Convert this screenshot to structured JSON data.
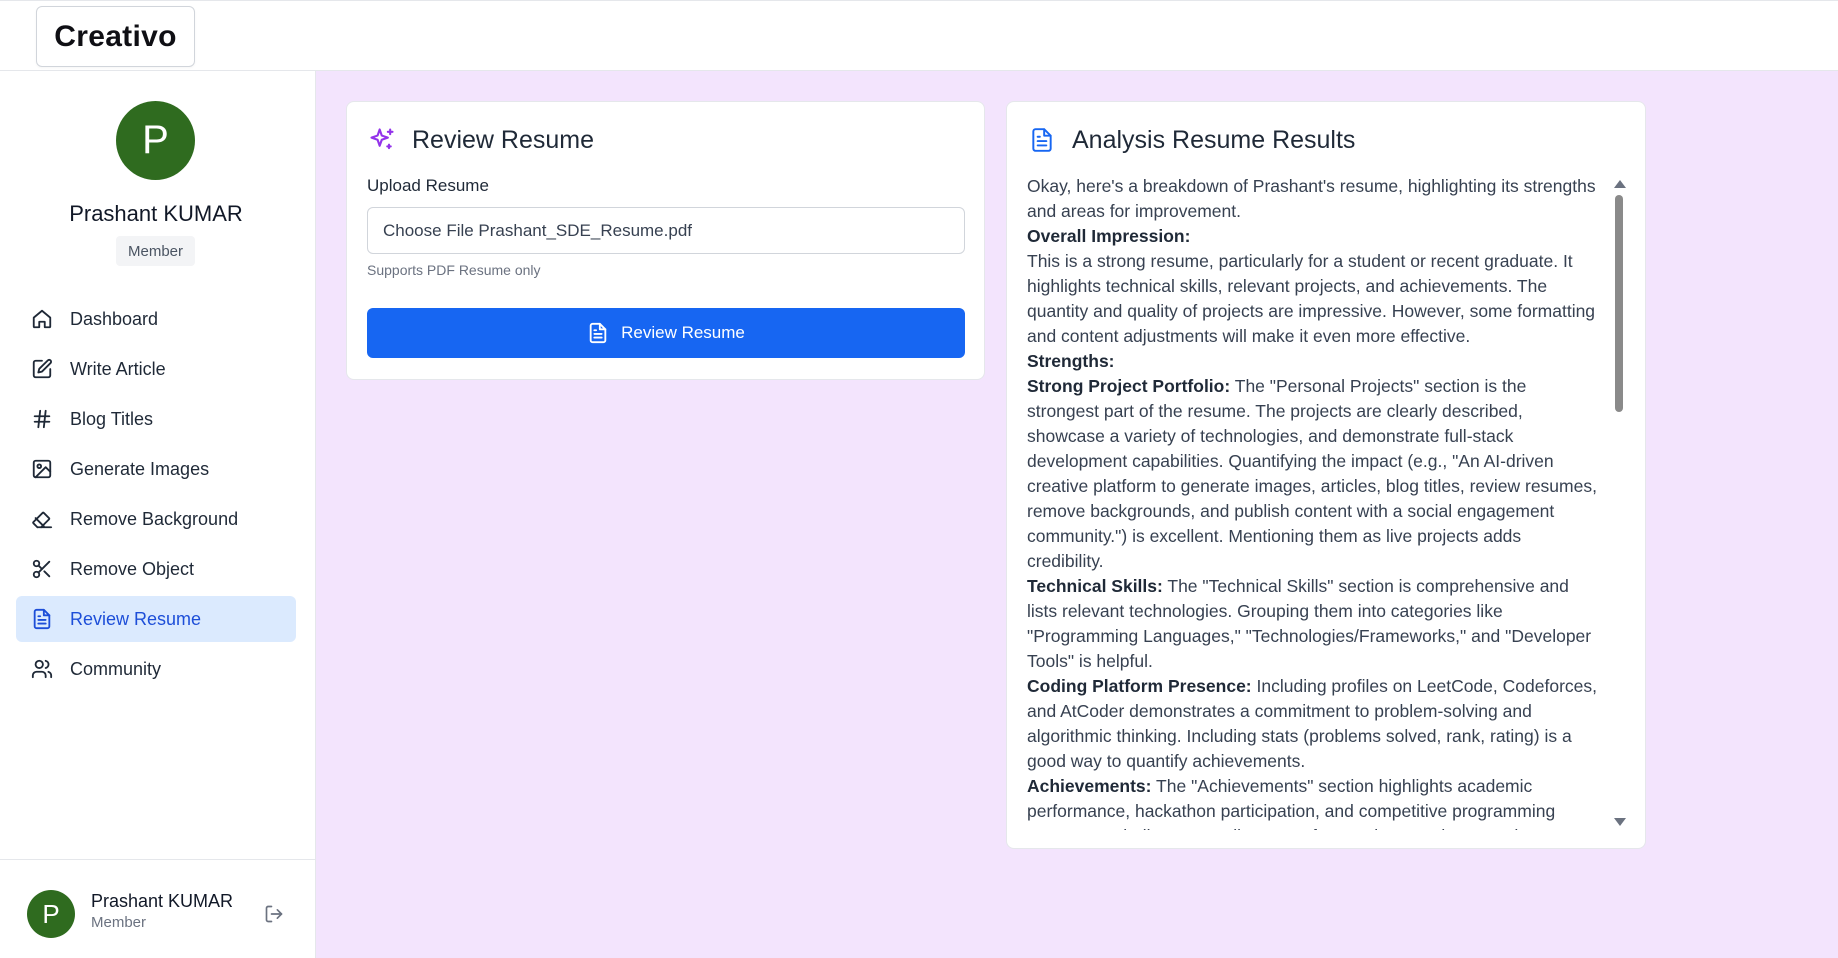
{
  "app": {
    "logo": "Creativo"
  },
  "sidebar": {
    "profile": {
      "initial": "P",
      "name": "Prashant KUMAR",
      "role": "Member"
    },
    "items": [
      {
        "label": "Dashboard",
        "icon": "home-icon",
        "active": false
      },
      {
        "label": "Write Article",
        "icon": "edit-icon",
        "active": false
      },
      {
        "label": "Blog Titles",
        "icon": "hash-icon",
        "active": false
      },
      {
        "label": "Generate Images",
        "icon": "image-icon",
        "active": false
      },
      {
        "label": "Remove Background",
        "icon": "eraser-icon",
        "active": false
      },
      {
        "label": "Remove Object",
        "icon": "scissors-icon",
        "active": false
      },
      {
        "label": "Review Resume",
        "icon": "file-text-icon",
        "active": true
      },
      {
        "label": "Community",
        "icon": "users-icon",
        "active": false
      }
    ],
    "footer": {
      "initial": "P",
      "name": "Prashant KUMAR",
      "role": "Member"
    }
  },
  "review_card": {
    "title": "Review Resume",
    "upload_label": "Upload Resume",
    "file_input_text": "Choose File Prashant_SDE_Resume.pdf",
    "hint": "Supports PDF Resume only",
    "button_label": "Review Resume"
  },
  "results_card": {
    "title": "Analysis Resume Results",
    "intro": "Okay, here's a breakdown of Prashant's resume, highlighting its strengths and areas for improvement.",
    "overall_heading": "Overall Impression:",
    "overall_text": "This is a strong resume, particularly for a student or recent graduate. It highlights technical skills, relevant projects, and achievements. The quantity and quality of projects are impressive. However, some formatting and content adjustments will make it even more effective.",
    "strengths_heading": "Strengths:",
    "points": [
      {
        "heading": "Strong Project Portfolio:",
        "text": " The \"Personal Projects\" section is the strongest part of the resume. The projects are clearly described, showcase a variety of technologies, and demonstrate full-stack development capabilities. Quantifying the impact (e.g., \"An AI-driven creative platform to generate images, articles, blog titles, review resumes, remove backgrounds, and publish content with a social engagement community.\") is excellent. Mentioning them as live projects adds credibility."
      },
      {
        "heading": "Technical Skills:",
        "text": " The \"Technical Skills\" section is comprehensive and lists relevant technologies. Grouping them into categories like \"Programming Languages,\" \"Technologies/Frameworks,\" and \"Developer Tools\" is helpful."
      },
      {
        "heading": "Coding Platform Presence:",
        "text": " Including profiles on LeetCode, Codeforces, and AtCoder demonstrates a commitment to problem-solving and algorithmic thinking. Including stats (problems solved, rank, rating) is a good way to quantify achievements."
      },
      {
        "heading": "Achievements:",
        "text": " The \"Achievements\" section highlights academic performance, hackathon participation, and competitive programming success. Including percentile scores for JEE is a good way to showcase aptitude."
      }
    ]
  }
}
